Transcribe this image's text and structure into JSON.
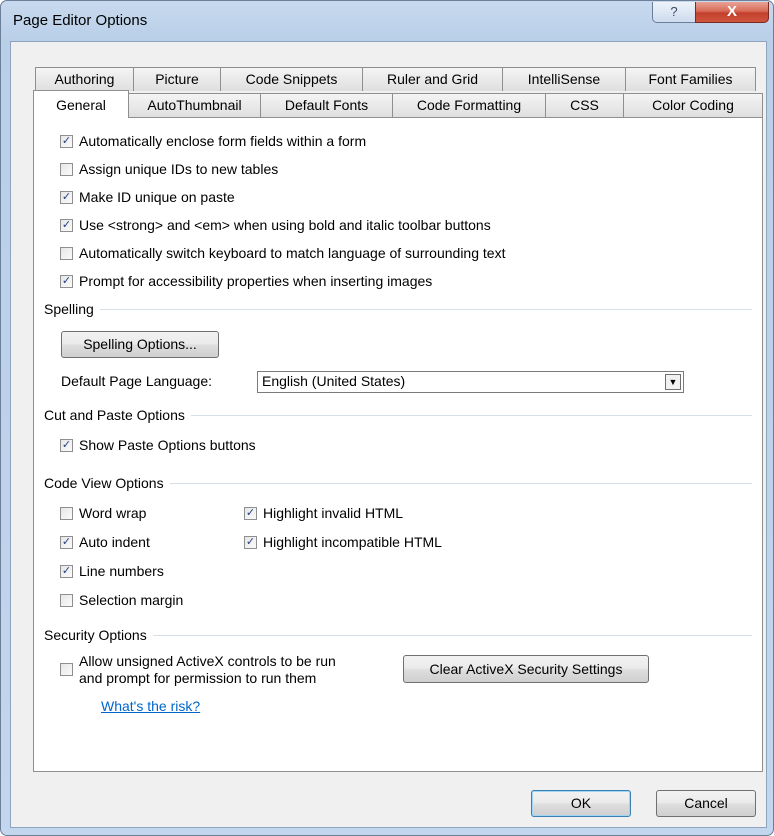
{
  "window": {
    "title": "Page Editor Options",
    "help_glyph": "?",
    "close_glyph": "X"
  },
  "tabs": {
    "row1": [
      "Authoring",
      "Picture",
      "Code Snippets",
      "Ruler and Grid",
      "IntelliSense",
      "Font Families"
    ],
    "row2": [
      "General",
      "AutoThumbnail",
      "Default Fonts",
      "Code Formatting",
      "CSS",
      "Color Coding"
    ],
    "active": "General"
  },
  "general": {
    "options": [
      {
        "label": "Automatically enclose form fields within a form",
        "checked": true
      },
      {
        "label": "Assign unique IDs to new tables",
        "checked": false
      },
      {
        "label": "Make ID unique on paste",
        "checked": true
      },
      {
        "label": "Use <strong> and <em> when using bold and italic toolbar buttons",
        "checked": true
      },
      {
        "label": "Automatically switch keyboard to match language of surrounding text",
        "checked": false
      },
      {
        "label": "Prompt for accessibility properties when inserting images",
        "checked": true
      }
    ]
  },
  "spelling": {
    "heading": "Spelling",
    "button": "Spelling Options...",
    "language_label": "Default Page Language:",
    "language_value": "English (United States)"
  },
  "cut_paste": {
    "heading": "Cut and Paste Options",
    "options": [
      {
        "label": "Show Paste Options buttons",
        "checked": true
      }
    ]
  },
  "code_view": {
    "heading": "Code View Options",
    "left": [
      {
        "label": "Word wrap",
        "checked": false
      },
      {
        "label": "Auto indent",
        "checked": true
      },
      {
        "label": "Line numbers",
        "checked": true
      },
      {
        "label": "Selection margin",
        "checked": false
      }
    ],
    "right": [
      {
        "label": "Highlight invalid HTML",
        "checked": true
      },
      {
        "label": "Highlight incompatible HTML",
        "checked": true
      }
    ]
  },
  "security": {
    "heading": "Security Options",
    "activex_line1": "Allow unsigned ActiveX controls to be run",
    "activex_line2": "and prompt for permission to run them",
    "activex_checked": false,
    "clear_button": "Clear ActiveX Security Settings",
    "risk_link": "What's the risk?"
  },
  "footer": {
    "ok": "OK",
    "cancel": "Cancel"
  }
}
